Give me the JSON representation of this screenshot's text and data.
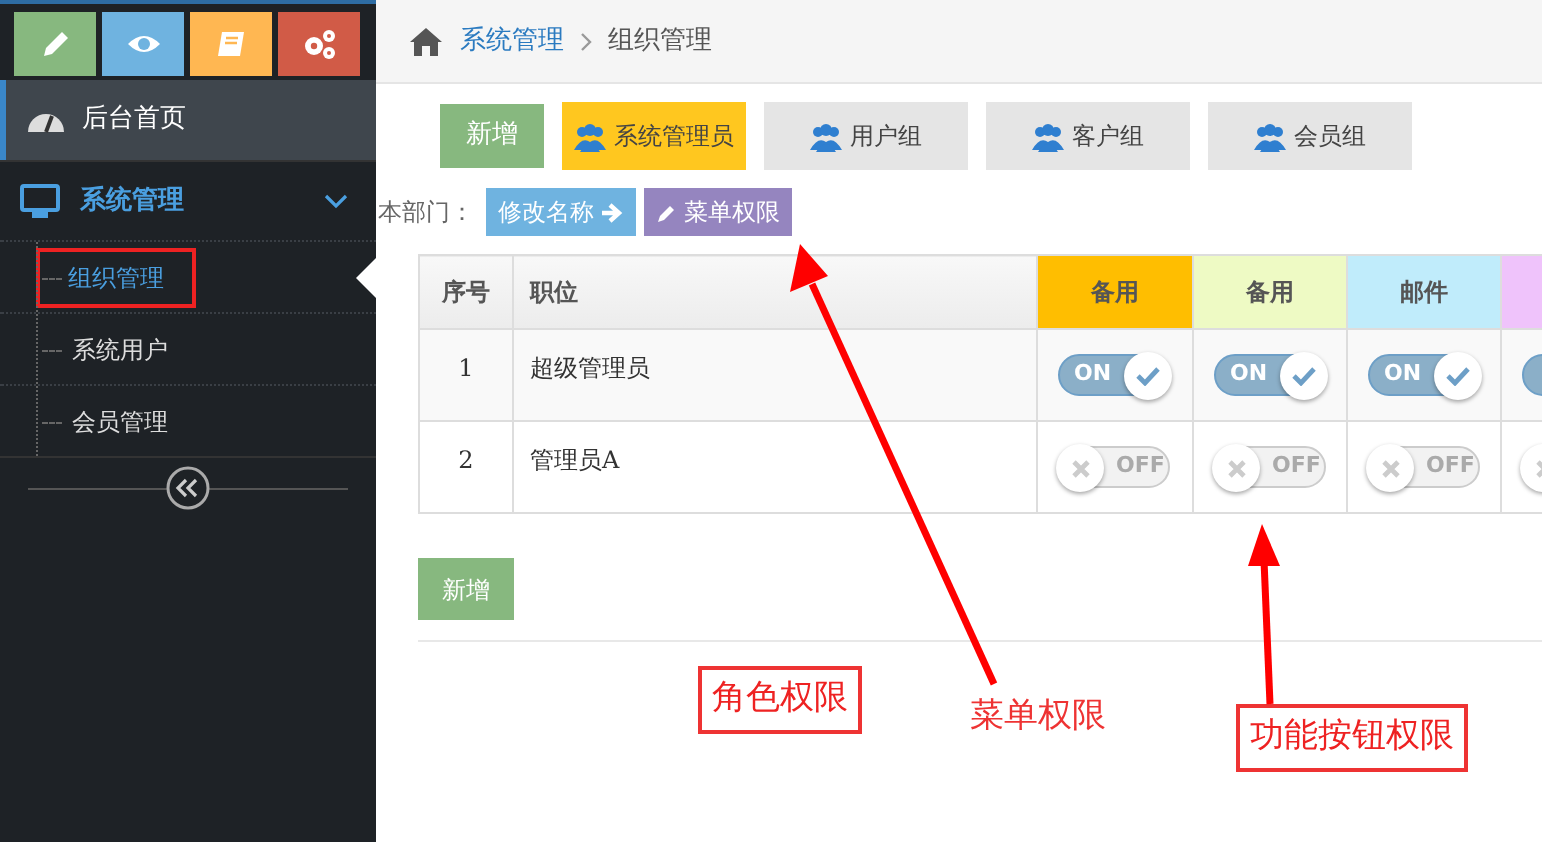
{
  "shortcuts": [
    {
      "kind": "pencil",
      "color": "#87b87f"
    },
    {
      "kind": "eye",
      "color": "#6fb3e0"
    },
    {
      "kind": "book",
      "color": "#ffb752"
    },
    {
      "kind": "gears",
      "color": "#d15b47"
    }
  ],
  "sidebar": {
    "items": [
      {
        "label": "后台首页",
        "kind": "dashboard"
      },
      {
        "label": "系统管理",
        "kind": "monitor",
        "expanded": true,
        "children": [
          {
            "label": "组织管理",
            "selected": true
          },
          {
            "label": "系统用户",
            "selected": false
          },
          {
            "label": "会员管理",
            "selected": false
          }
        ]
      }
    ]
  },
  "breadcrumb": [
    "系统管理",
    "组织管理"
  ],
  "toolbar": {
    "add_button": "新增",
    "groups": [
      {
        "label": "系统管理员",
        "selected": true
      },
      {
        "label": "用户组",
        "selected": false
      },
      {
        "label": "客户组",
        "selected": false
      },
      {
        "label": "会员组",
        "selected": false
      }
    ]
  },
  "department": {
    "label": "本部门：",
    "buttons": [
      {
        "label": "修改名称",
        "kind": "rename",
        "color": "#6fb3e0"
      },
      {
        "label": "菜单权限",
        "kind": "menu",
        "color": "#9585bf"
      }
    ]
  },
  "table": {
    "columns": [
      {
        "label": "序号"
      },
      {
        "label": "职位"
      },
      {
        "label": "备用",
        "color": "#ffbe00"
      },
      {
        "label": "备用",
        "color": "#eefac4"
      },
      {
        "label": "邮件",
        "color": "#c0ecfb"
      },
      {
        "color": "#efc3fb"
      }
    ],
    "rows": [
      {
        "cells": [
          "1",
          "超级管理员"
        ],
        "toggles": [
          {
            "on": true,
            "text": "ON"
          },
          {
            "on": true,
            "text": "ON"
          },
          {
            "on": true,
            "text": "ON"
          },
          {
            "on": true
          }
        ]
      },
      {
        "cells": [
          "2",
          "管理员A"
        ],
        "toggles": [
          {
            "on": false,
            "text": "OFF"
          },
          {
            "on": false,
            "text": "OFF"
          },
          {
            "on": false,
            "text": "OFF"
          },
          {
            "on": false
          }
        ]
      }
    ]
  },
  "bottom_add_button": "新增",
  "annotations": [
    {
      "text": "角色权限",
      "kind": "boxed"
    },
    {
      "text": "菜单权限",
      "kind": "plain"
    },
    {
      "text": "功能按钮权限",
      "kind": "boxed"
    }
  ]
}
